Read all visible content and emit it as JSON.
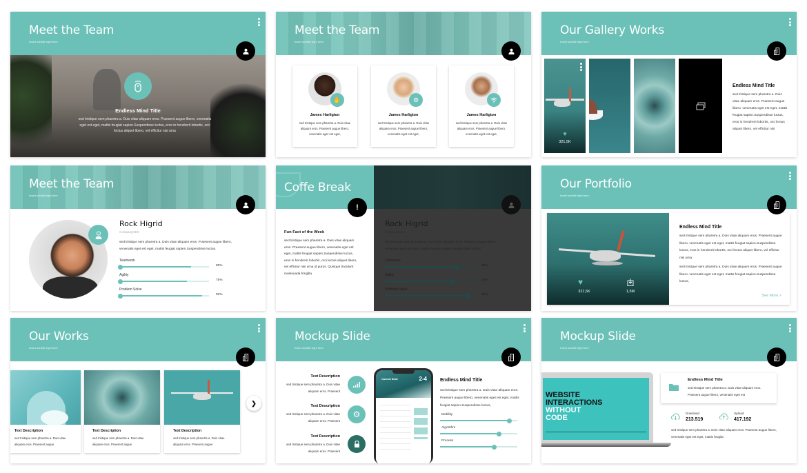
{
  "colors": {
    "accent": "#6bc1b8",
    "dark": "#000000",
    "text": "#333333"
  },
  "slides": [
    {
      "title": "Meet the Team",
      "subtitle": "Insert subtitle right here",
      "badge_icon": "user-icon",
      "feature_icon": "mouse-icon",
      "heading": "Endless Mind Title",
      "body": "sed tristique sem pharetra a. Duis vitae aliquam eros. Praesent augue libero, venenatis eget est eget, mattis feugiat sapien.Suspendisse luctus, eros in hendrerit lobortis, orci lectus aliquet libero, vel efficitur nisi urna"
    },
    {
      "title": "Meet the Team",
      "subtitle": "Insert subtitle right here",
      "badge_icon": "user-icon",
      "members": [
        {
          "name": "James Harligton",
          "bio": "sed tristique sem pharetra a. Duis vitae aliquam eros. Praesent augue libero, venenatis eget est eget,",
          "icon": "hand-icon"
        },
        {
          "name": "James Harligton",
          "bio": "sed tristique sem pharetra a. Duis vitae aliquam eros. Praesent augue libero, venenatis eget est eget,",
          "icon": "gears-icon"
        },
        {
          "name": "James Harligton",
          "bio": "sed tristique sem pharetra a. Duis vitae aliquam eros. Praesent augue libero, venenatis eget est eget,",
          "icon": "wifi-icon"
        }
      ]
    },
    {
      "title": "Our Gallery Works",
      "subtitle": "Insert subtitle right here",
      "badge_icon": "building-icon",
      "likes": "321,5K",
      "heading": "Endless Mind Title",
      "body": "sed tristique sem pharetra a. Duis vitae aliquam eros. Praesent augue libero, venenatis eget est eget, mattis feugiat sapien.Suspendisse luctus, eros in hendrerit lobortis, orci lectus aliquet libero, vel efficitur nisi"
    },
    {
      "title": "Meet the Team",
      "subtitle": "Insert subtitle right here",
      "badge_icon": "user-icon",
      "name": "Rock Higrid",
      "role": "CompanyCEO",
      "body": "sed tristique sem pharetra a. Duis vitae aliquam eros. Praesent augue libero, venenatis eget est eget, mattis feugiat sapien.Suspendisse luctus.",
      "skills": [
        {
          "label": "Teamwork",
          "value": 80,
          "display": "80%"
        },
        {
          "label": "Agility",
          "value": 75,
          "display": "75%"
        },
        {
          "label": "Problem  Solve",
          "value": 92,
          "display": "92%"
        }
      ]
    },
    {
      "title": "Coffe Break",
      "badge_icon": "exclamation-icon",
      "heading": "Fun Fact of the Week",
      "body": "sed tristique sem pharetra a. Duis vitae aliquam eros. Praesent augue libero, venenatis eget est eget, mattis feugiat sapien.Suspendisse luctus, eros in hendrerit lobortis, orci lectus aliquet libero, vel efficitur nisi urna id purus. Quisque tincidunt malesuada fringilla",
      "overlay": {
        "name": "Rock Higrid",
        "role": "CompanyCEO",
        "body": "sed tristique sem pharetra a. Duis vitae aliquam eros. Praesent augue libero, venenatis eget est eget, mattis feugiat sapien.Suspendisse luctus.",
        "skills": [
          {
            "label": "Teamwork",
            "value": 80,
            "display": "80%"
          },
          {
            "label": "Agility",
            "value": 75,
            "display": "75%"
          },
          {
            "label": "Problem  Solve",
            "value": 92,
            "display": "92%"
          }
        ]
      }
    },
    {
      "title": "Our Portfolio",
      "subtitle": "Insert subtitle right here",
      "badge_icon": "building-icon",
      "likes": "321,5K",
      "downloads": "1,5M",
      "heading": "Endless Mind Title",
      "body1": "sed tristique sem pharetra a. Duis vitae aliquam eros. Praesent augue libero, venenatis eget est eget, mattis feugiat sapien.Suspendisse luctus, eros in hendrerit lobortis, orci lectus aliquet libero, vel efficitur nisi urna",
      "body2": "sed tristique sem pharetra a. Duis vitae aliquam eros. Praesent augue libero, venenatis eget est eget, mattis feugiat sapien.Suspendisse luctus,",
      "see_more": "See More >"
    },
    {
      "title": "Our Works",
      "subtitle": "Insert subtitle right here",
      "badge_icon": "building-icon",
      "next_label": "❯",
      "works": [
        {
          "title": "Text Description",
          "body": "sed tristique sem pharetra a. Duis vitae aliquam eros. Praesent augue"
        },
        {
          "title": "Text Description",
          "body": "sed tristique sem pharetra a. Duis vitae aliquam eros. Praesent augue"
        },
        {
          "title": "Text Description",
          "body": "sed tristique sem pharetra a. Duis vitae aliquam eros. Praesent augue"
        }
      ]
    },
    {
      "title": "Mockup Slide",
      "subtitle": "Insert subtitle right here",
      "badge_icon": "building-icon",
      "features": [
        {
          "title": "Text Description",
          "body": "sed tristique sem pharetra a. Duis vitae aliquam eros. Praesent",
          "icon": "signal-icon"
        },
        {
          "title": "Text Description",
          "body": "sed tristique sem pharetra a. Duis vitae aliquam eros. Praesent",
          "icon": "gear-icon"
        },
        {
          "title": "Text Description",
          "body": "sed tristique sem pharetra a. Duis vitae aliquam eros. Praesent",
          "icon": "lock-icon"
        }
      ],
      "phone_header": "Cannot Beat",
      "phone_score": "2-4",
      "heading": "Endless Mind Title",
      "body": "sed tristique sem pharetra a. Duis vitae aliquam eros. Praesent augue libero, venenatis eget est eget, mattis feugiat sapien.Suspendisse luctus,",
      "sliders": [
        {
          "label": "Mobility",
          "value": 90
        },
        {
          "label": "Algorithm",
          "value": 76
        },
        {
          "label": "Process",
          "value": 70
        }
      ]
    },
    {
      "title": "Mockup Slide",
      "subtitle": "Insert subtitle right here",
      "badge_icon": "building-icon",
      "laptop_headline": [
        "WEBSITE",
        "INTERACTIONS",
        "WITHOUT",
        "CODE"
      ],
      "card_heading": "Endless Mind Title",
      "card_body": "sed tristique sem pharetra a. Duis vitae aliquam eros. Praesent augue libero, venenatis eget est",
      "download_label": "Download",
      "download_value": "213.519",
      "upload_label": "Upload",
      "upload_value": "417.192",
      "body": "sed tristique sem pharetra a. Duis vitae aliquam eros. Praesent augue libero, venenatis eget est eget, mattis feugiat"
    }
  ]
}
